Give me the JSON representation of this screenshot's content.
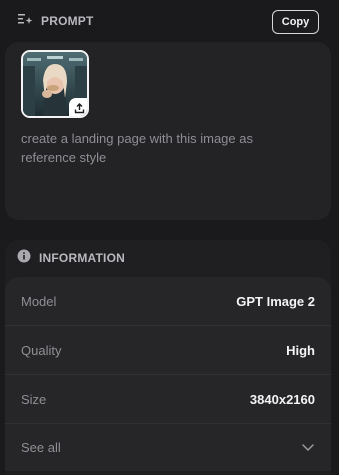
{
  "prompt": {
    "section_title": "PROMPT",
    "copy_label": "Copy",
    "text": "create a landing page with this image as reference style",
    "icons": {
      "header": "sparkle-list-icon",
      "upload": "upload-icon"
    }
  },
  "information": {
    "section_title": "INFORMATION",
    "icon": "info-circle-icon",
    "rows": [
      {
        "label": "Model",
        "value": "GPT Image 2"
      },
      {
        "label": "Quality",
        "value": "High"
      },
      {
        "label": "Size",
        "value": "3840x2160"
      }
    ],
    "see_all_label": "See all",
    "see_all_icon": "chevron-down-icon"
  }
}
